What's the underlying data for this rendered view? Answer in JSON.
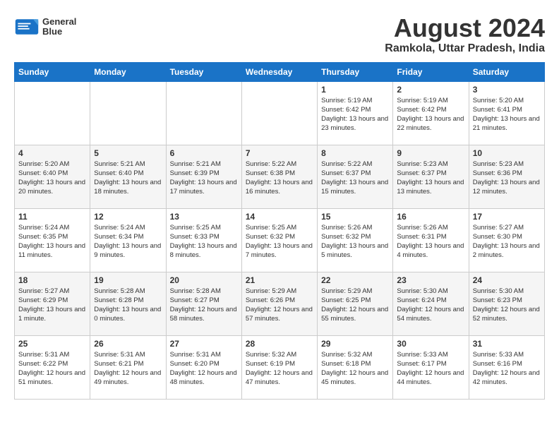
{
  "header": {
    "logo_line1": "General",
    "logo_line2": "Blue",
    "title": "August 2024",
    "subtitle": "Ramkola, Uttar Pradesh, India"
  },
  "weekdays": [
    "Sunday",
    "Monday",
    "Tuesday",
    "Wednesday",
    "Thursday",
    "Friday",
    "Saturday"
  ],
  "weeks": [
    [
      {
        "day": "",
        "info": ""
      },
      {
        "day": "",
        "info": ""
      },
      {
        "day": "",
        "info": ""
      },
      {
        "day": "",
        "info": ""
      },
      {
        "day": "1",
        "info": "Sunrise: 5:19 AM\nSunset: 6:42 PM\nDaylight: 13 hours\nand 23 minutes."
      },
      {
        "day": "2",
        "info": "Sunrise: 5:19 AM\nSunset: 6:42 PM\nDaylight: 13 hours\nand 22 minutes."
      },
      {
        "day": "3",
        "info": "Sunrise: 5:20 AM\nSunset: 6:41 PM\nDaylight: 13 hours\nand 21 minutes."
      }
    ],
    [
      {
        "day": "4",
        "info": "Sunrise: 5:20 AM\nSunset: 6:40 PM\nDaylight: 13 hours\nand 20 minutes."
      },
      {
        "day": "5",
        "info": "Sunrise: 5:21 AM\nSunset: 6:40 PM\nDaylight: 13 hours\nand 18 minutes."
      },
      {
        "day": "6",
        "info": "Sunrise: 5:21 AM\nSunset: 6:39 PM\nDaylight: 13 hours\nand 17 minutes."
      },
      {
        "day": "7",
        "info": "Sunrise: 5:22 AM\nSunset: 6:38 PM\nDaylight: 13 hours\nand 16 minutes."
      },
      {
        "day": "8",
        "info": "Sunrise: 5:22 AM\nSunset: 6:37 PM\nDaylight: 13 hours\nand 15 minutes."
      },
      {
        "day": "9",
        "info": "Sunrise: 5:23 AM\nSunset: 6:37 PM\nDaylight: 13 hours\nand 13 minutes."
      },
      {
        "day": "10",
        "info": "Sunrise: 5:23 AM\nSunset: 6:36 PM\nDaylight: 13 hours\nand 12 minutes."
      }
    ],
    [
      {
        "day": "11",
        "info": "Sunrise: 5:24 AM\nSunset: 6:35 PM\nDaylight: 13 hours\nand 11 minutes."
      },
      {
        "day": "12",
        "info": "Sunrise: 5:24 AM\nSunset: 6:34 PM\nDaylight: 13 hours\nand 9 minutes."
      },
      {
        "day": "13",
        "info": "Sunrise: 5:25 AM\nSunset: 6:33 PM\nDaylight: 13 hours\nand 8 minutes."
      },
      {
        "day": "14",
        "info": "Sunrise: 5:25 AM\nSunset: 6:32 PM\nDaylight: 13 hours\nand 7 minutes."
      },
      {
        "day": "15",
        "info": "Sunrise: 5:26 AM\nSunset: 6:32 PM\nDaylight: 13 hours\nand 5 minutes."
      },
      {
        "day": "16",
        "info": "Sunrise: 5:26 AM\nSunset: 6:31 PM\nDaylight: 13 hours\nand 4 minutes."
      },
      {
        "day": "17",
        "info": "Sunrise: 5:27 AM\nSunset: 6:30 PM\nDaylight: 13 hours\nand 2 minutes."
      }
    ],
    [
      {
        "day": "18",
        "info": "Sunrise: 5:27 AM\nSunset: 6:29 PM\nDaylight: 13 hours\nand 1 minute."
      },
      {
        "day": "19",
        "info": "Sunrise: 5:28 AM\nSunset: 6:28 PM\nDaylight: 13 hours\nand 0 minutes."
      },
      {
        "day": "20",
        "info": "Sunrise: 5:28 AM\nSunset: 6:27 PM\nDaylight: 12 hours\nand 58 minutes."
      },
      {
        "day": "21",
        "info": "Sunrise: 5:29 AM\nSunset: 6:26 PM\nDaylight: 12 hours\nand 57 minutes."
      },
      {
        "day": "22",
        "info": "Sunrise: 5:29 AM\nSunset: 6:25 PM\nDaylight: 12 hours\nand 55 minutes."
      },
      {
        "day": "23",
        "info": "Sunrise: 5:30 AM\nSunset: 6:24 PM\nDaylight: 12 hours\nand 54 minutes."
      },
      {
        "day": "24",
        "info": "Sunrise: 5:30 AM\nSunset: 6:23 PM\nDaylight: 12 hours\nand 52 minutes."
      }
    ],
    [
      {
        "day": "25",
        "info": "Sunrise: 5:31 AM\nSunset: 6:22 PM\nDaylight: 12 hours\nand 51 minutes."
      },
      {
        "day": "26",
        "info": "Sunrise: 5:31 AM\nSunset: 6:21 PM\nDaylight: 12 hours\nand 49 minutes."
      },
      {
        "day": "27",
        "info": "Sunrise: 5:31 AM\nSunset: 6:20 PM\nDaylight: 12 hours\nand 48 minutes."
      },
      {
        "day": "28",
        "info": "Sunrise: 5:32 AM\nSunset: 6:19 PM\nDaylight: 12 hours\nand 47 minutes."
      },
      {
        "day": "29",
        "info": "Sunrise: 5:32 AM\nSunset: 6:18 PM\nDaylight: 12 hours\nand 45 minutes."
      },
      {
        "day": "30",
        "info": "Sunrise: 5:33 AM\nSunset: 6:17 PM\nDaylight: 12 hours\nand 44 minutes."
      },
      {
        "day": "31",
        "info": "Sunrise: 5:33 AM\nSunset: 6:16 PM\nDaylight: 12 hours\nand 42 minutes."
      }
    ]
  ]
}
